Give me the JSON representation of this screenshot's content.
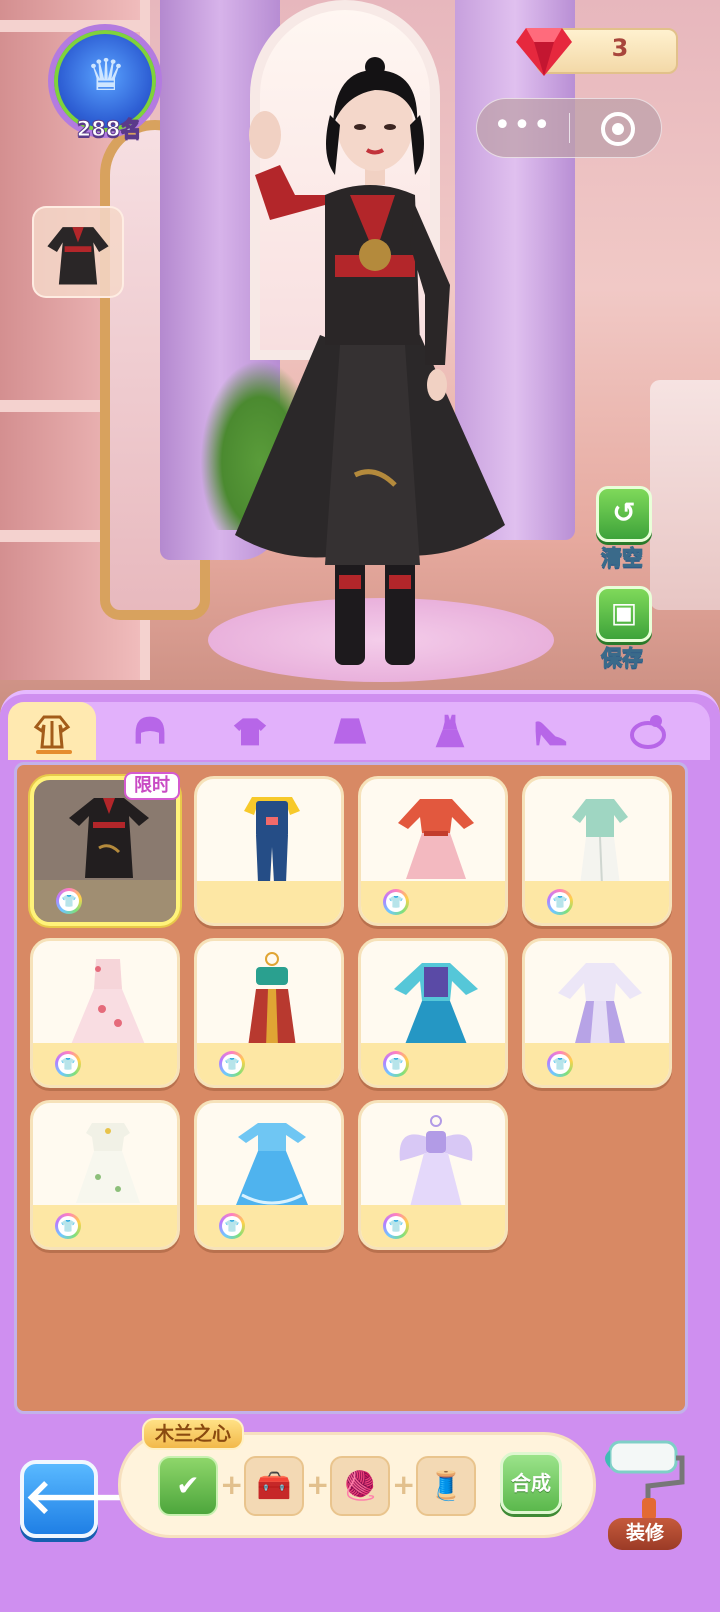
{
  "hud": {
    "rank_text": "288名",
    "gem_count": "3",
    "capsule_more": "•••"
  },
  "side_buttons": {
    "clear_label": "清空",
    "save_label": "保存"
  },
  "tabs": [
    {
      "name": "outfit",
      "icon": "hanfu-icon",
      "active": true
    },
    {
      "name": "hair",
      "icon": "hair-icon",
      "active": false
    },
    {
      "name": "top",
      "icon": "shirt-icon",
      "active": false
    },
    {
      "name": "skirt",
      "icon": "skirt-icon",
      "active": false
    },
    {
      "name": "dress",
      "icon": "dress-icon",
      "active": false
    },
    {
      "name": "shoes",
      "icon": "high-heel-icon",
      "active": false
    },
    {
      "name": "accessory",
      "icon": "accessory-icon",
      "active": false
    }
  ],
  "items": [
    {
      "id": "black-red-warrior-robe",
      "tag": "限时",
      "selected": true
    },
    {
      "id": "denim-overalls"
    },
    {
      "id": "red-pink-dress"
    },
    {
      "id": "mint-qipao-skirt"
    },
    {
      "id": "floral-pink-gown"
    },
    {
      "id": "teal-red-dancer-outfit"
    },
    {
      "id": "blue-hanfu-dress"
    },
    {
      "id": "lavender-hanfu"
    },
    {
      "id": "white-floral-dress"
    },
    {
      "id": "blue-ruffle-dress"
    },
    {
      "id": "lilac-fairy-dress"
    }
  ],
  "craft": {
    "title": "木兰之心",
    "button_label": "合成"
  },
  "decorate_label": "装修",
  "colors": {
    "panel": "#cf8ff0",
    "grid_background": "#d88964",
    "accent_green": "#5bb84c",
    "back_button_blue": "#1f7fe5"
  }
}
